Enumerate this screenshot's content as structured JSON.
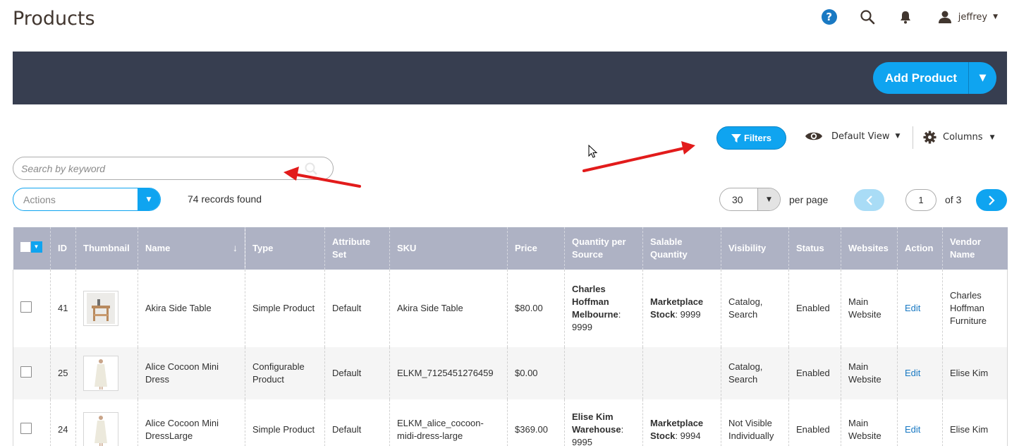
{
  "page": {
    "title": "Products"
  },
  "header": {
    "user_name": "jeffrey",
    "help_glyph": "?"
  },
  "action_bar": {
    "add_product_label": "Add Product"
  },
  "toolbar": {
    "filters_label": "Filters",
    "view_label": "Default View",
    "columns_label": "Columns",
    "search_placeholder": "Search by keyword",
    "actions_label": "Actions",
    "records_found": "74 records found",
    "per_page_value": "30",
    "per_page_label": "per page",
    "current_page": "1",
    "page_of": "of 3"
  },
  "table": {
    "headers": {
      "id": "ID",
      "thumbnail": "Thumbnail",
      "name": "Name",
      "sort_arrow": "↓",
      "type": "Type",
      "attribute_set": "Attribute Set",
      "sku": "SKU",
      "price": "Price",
      "qty_per_source": "Quantity per Source",
      "salable_qty": "Salable Quantity",
      "visibility": "Visibility",
      "status": "Status",
      "websites": "Websites",
      "action": "Action",
      "vendor_name": "Vendor Name"
    },
    "rows": [
      {
        "id": "41",
        "name": "Akira Side Table",
        "type": "Simple Product",
        "attribute_set": "Default",
        "sku": "Akira Side Table",
        "price": "$80.00",
        "qty_source_name": "Charles Hoffman Melbourne",
        "qty_source_value": ": 9999",
        "salable_name": "Marketplace Stock",
        "salable_value": ": 9999",
        "visibility": "Catalog, Search",
        "status": "Enabled",
        "websites": "Main Website",
        "action": "Edit",
        "vendor": "Charles Hoffman Furniture"
      },
      {
        "id": "25",
        "name": "Alice Cocoon Mini Dress",
        "type": "Configurable Product",
        "attribute_set": "Default",
        "sku": "ELKM_7125451276459",
        "price": "$0.00",
        "qty_source_name": "",
        "qty_source_value": "",
        "salable_name": "",
        "salable_value": "",
        "visibility": "Catalog, Search",
        "status": "Enabled",
        "websites": "Main Website",
        "action": "Edit",
        "vendor": "Elise Kim"
      },
      {
        "id": "24",
        "name": "Alice Cocoon Mini DressLarge",
        "type": "Simple Product",
        "attribute_set": "Default",
        "sku": "ELKM_alice_cocoon-midi-dress-large",
        "price": "$369.00",
        "qty_source_name": "Elise Kim Warehouse",
        "qty_source_value": ": 9995",
        "salable_name": "Marketplace Stock",
        "salable_value": ": 9994",
        "visibility": "Not Visible Individually",
        "status": "Enabled",
        "websites": "Main Website",
        "action": "Edit",
        "vendor": "Elise Kim"
      }
    ]
  },
  "colors": {
    "accent": "#0fa4f0",
    "header_bar": "#373e50",
    "table_header": "#aeb2c4",
    "annotation_arrow": "#e21b1b",
    "link": "#1979c3"
  }
}
